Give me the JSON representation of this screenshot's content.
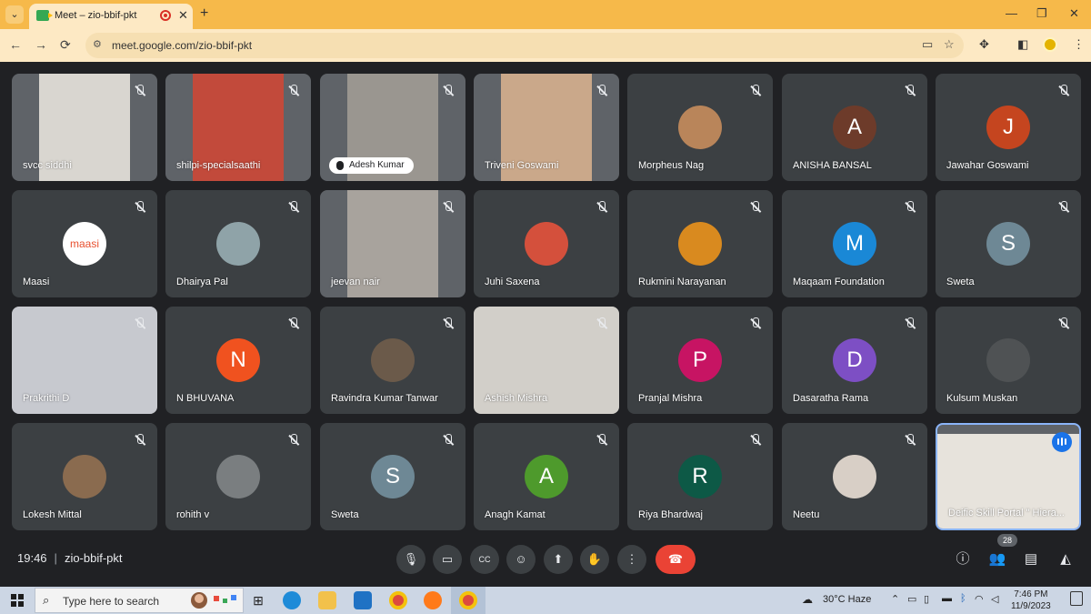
{
  "browser": {
    "tab_title": "Meet – zio-bbif-pkt",
    "tab_close": "✕",
    "new_tab": "+",
    "url": "meet.google.com/zio-bbif-pkt",
    "window_controls": [
      "—",
      "❐",
      "✕"
    ],
    "nav": [
      "←",
      "→",
      "⟳"
    ]
  },
  "participants": [
    {
      "name": "svcc siddhi",
      "kind": "video",
      "bg": "#d9d6d0"
    },
    {
      "name": "shilpi-specialsaathi",
      "kind": "video",
      "bg": "#c24a3b"
    },
    {
      "name": "Adesh Kumar",
      "kind": "video-pill",
      "bg": "#9a9690"
    },
    {
      "name": "Triveni Goswami",
      "kind": "video",
      "bg": "#caa88a"
    },
    {
      "name": "Morpheus Nag",
      "kind": "photo",
      "bg": "#b9855a"
    },
    {
      "name": "ANISHA BANSAL",
      "kind": "letter",
      "letter": "A",
      "color": "#6d3b2a"
    },
    {
      "name": "Jawahar Goswami",
      "kind": "letter",
      "letter": "J",
      "color": "#c5451f"
    },
    {
      "name": "Maasi",
      "kind": "logo",
      "logo_text": "maasi",
      "bg": "#ffffff"
    },
    {
      "name": "Dhairya Pal",
      "kind": "photo",
      "bg": "#8fa3a8"
    },
    {
      "name": "jeevan nair",
      "kind": "video",
      "bg": "#a8a39d"
    },
    {
      "name": "Juhi Saxena",
      "kind": "photo",
      "bg": "#d4503c"
    },
    {
      "name": "Rukmini Narayanan",
      "kind": "photo",
      "bg": "#d98a1f"
    },
    {
      "name": "Maqaam Foundation",
      "kind": "letter",
      "letter": "M",
      "color": "#1a88d6"
    },
    {
      "name": "Sweta",
      "kind": "letter",
      "letter": "S",
      "color": "#6e8895"
    },
    {
      "name": "Prakrithi D",
      "kind": "video",
      "bg": "#c7c9cf"
    },
    {
      "name": "N BHUVANA",
      "kind": "letter",
      "letter": "N",
      "color": "#f0521f"
    },
    {
      "name": "Ravindra Kumar Tanwar",
      "kind": "photo",
      "bg": "#6b5a4a"
    },
    {
      "name": "Ashish Mishra",
      "kind": "video",
      "bg": "#d2cfc9"
    },
    {
      "name": "Pranjal Mishra",
      "kind": "letter",
      "letter": "P",
      "color": "#c71463"
    },
    {
      "name": "Dasaratha Rama",
      "kind": "letter",
      "letter": "D",
      "color": "#7d4fc4"
    },
    {
      "name": "Kulsum Muskan",
      "kind": "photo",
      "bg": "#4f5254"
    },
    {
      "name": "Lokesh Mittal",
      "kind": "photo",
      "bg": "#8a6b4f"
    },
    {
      "name": "rohith v",
      "kind": "photo",
      "bg": "#7a7e80"
    },
    {
      "name": "Sweta",
      "kind": "letter",
      "letter": "S",
      "color": "#6e8895"
    },
    {
      "name": "Anagh Kamat",
      "kind": "letter",
      "letter": "A",
      "color": "#4e9a2c"
    },
    {
      "name": "Riya Bhardwaj",
      "kind": "letter",
      "letter": "R",
      "color": "#0d5946"
    },
    {
      "name": "Neetu",
      "kind": "photo",
      "bg": "#d8cfc6"
    },
    {
      "name": "Deific Skill Portal \" Hiera...",
      "kind": "video-active",
      "bg": "#e7e3dc"
    }
  ],
  "meeting": {
    "time": "19:46",
    "separator": "|",
    "code": "zio-bbif-pkt",
    "participant_count": "28"
  },
  "controls": [
    {
      "id": "mic",
      "glyph": "🎙"
    },
    {
      "id": "camera",
      "glyph": "▭"
    },
    {
      "id": "captions",
      "glyph": "CC"
    },
    {
      "id": "emoji",
      "glyph": "☺"
    },
    {
      "id": "present",
      "glyph": "⬆"
    },
    {
      "id": "raise-hand",
      "glyph": "✋"
    },
    {
      "id": "more",
      "glyph": "⋮"
    },
    {
      "id": "leave",
      "glyph": "☎"
    }
  ],
  "right_controls": [
    {
      "id": "info",
      "glyph": "ⓘ"
    },
    {
      "id": "people",
      "glyph": "👥"
    },
    {
      "id": "chat",
      "glyph": "▤"
    },
    {
      "id": "activities",
      "glyph": "◭"
    }
  ],
  "taskbar": {
    "search_placeholder": "Type here to search",
    "weather": "30°C  Haze",
    "time": "7:46 PM",
    "date": "11/9/2023"
  }
}
